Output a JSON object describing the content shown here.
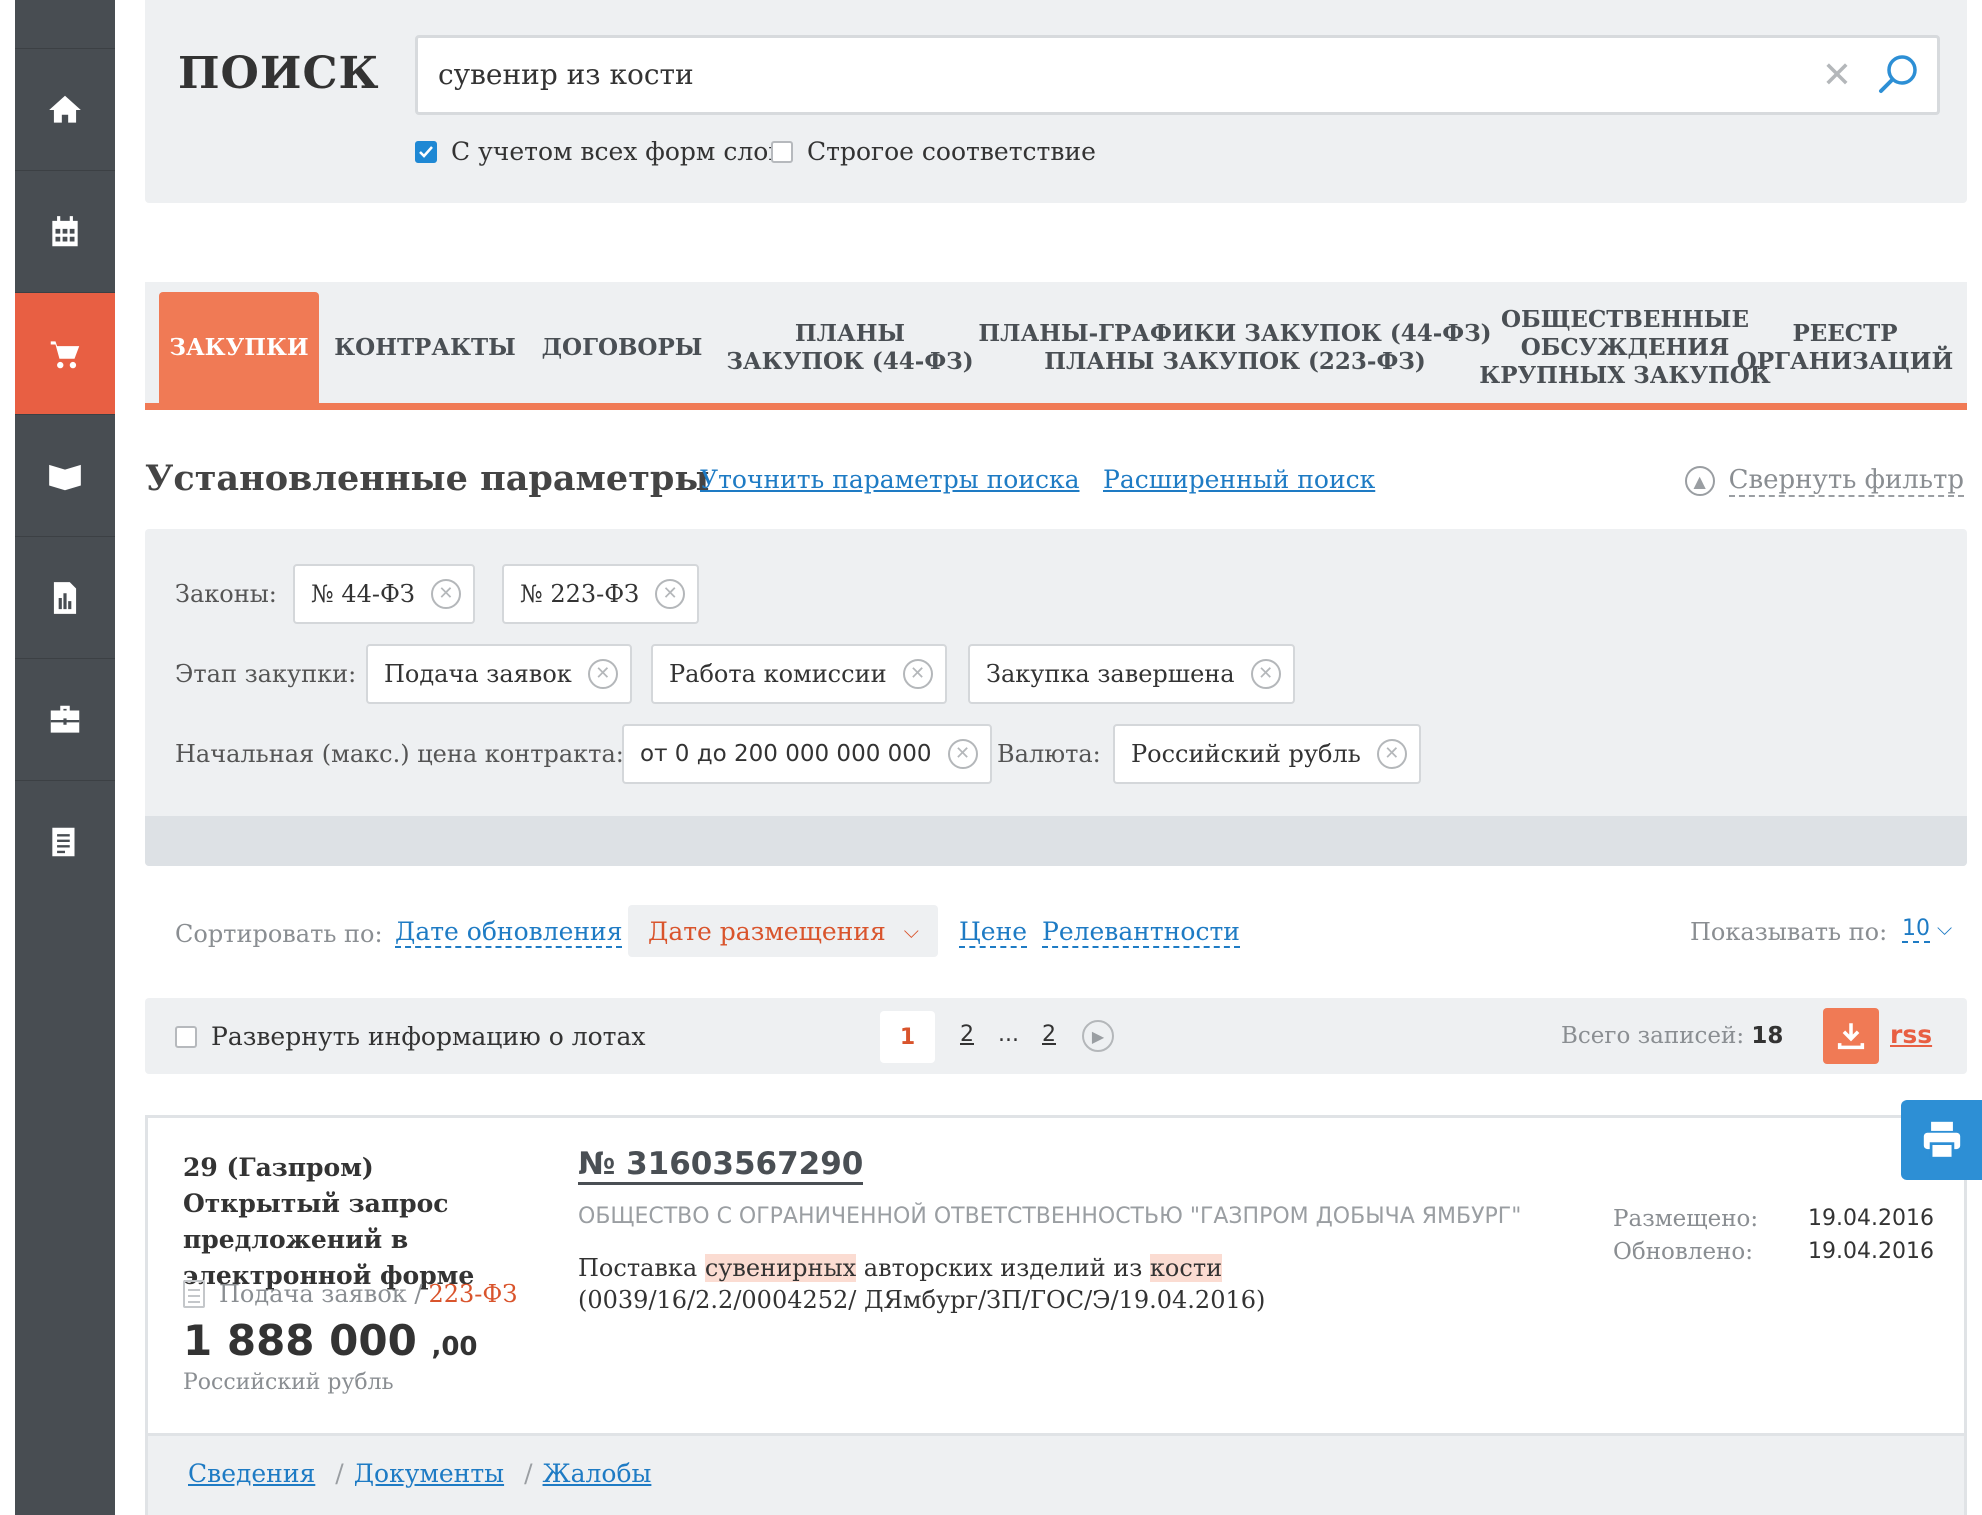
{
  "search": {
    "title": "ПОИСК",
    "query": "сувенир из кости",
    "option_all_forms": "С учетом всех форм слов",
    "option_all_forms_checked": true,
    "option_strict": "Строгое соответствие",
    "option_strict_checked": false
  },
  "tabs": [
    {
      "label": "ЗАКУПКИ",
      "active": true
    },
    {
      "label": "КОНТРАКТЫ"
    },
    {
      "label": "ДОГОВОРЫ"
    },
    {
      "label": "ПЛАНЫ\nЗАКУПОК (44-ФЗ)"
    },
    {
      "label": "ПЛАНЫ-ГРАФИКИ ЗАКУПОК (44-ФЗ)\nПЛАНЫ ЗАКУПОК (223-ФЗ)"
    },
    {
      "label": "ОБЩЕСТВЕННЫЕ\nОБСУЖДЕНИЯ\nКРУПНЫХ ЗАКУПОК"
    },
    {
      "label": "РЕЕСТР\nОРГАНИЗАЦИЙ"
    }
  ],
  "params": {
    "title": "Установленные параметры",
    "refine_link": "Уточнить параметры поиска",
    "advanced_link": "Расширенный поиск",
    "collapse_label": "Свернуть фильтр",
    "laws_label": "Законы:",
    "laws": [
      "№ 44-ФЗ",
      "№ 223-ФЗ"
    ],
    "stage_label": "Этап закупки:",
    "stages": [
      "Подача заявок",
      "Работа комиссии",
      "Закупка завершена"
    ],
    "price_label": "Начальная (макс.) цена контракта:",
    "price_value": "от 0 до 200 000 000 000",
    "currency_label": "Валюта:",
    "currency_value": "Российский рубль"
  },
  "sort": {
    "label": "Сортировать по:",
    "options": [
      "Дате обновления",
      "Дате размещения",
      "Цене",
      "Релевантности"
    ],
    "active": "Дате размещения",
    "show_label": "Показывать по:",
    "show_value": "10"
  },
  "toolbar": {
    "expand_label": "Развернуть информацию о лотах",
    "pages": [
      "1",
      "2",
      "...",
      "2"
    ],
    "current_page": "1",
    "total_label": "Всего записей:",
    "total_value": "18",
    "rss_label": "rss"
  },
  "result": {
    "procedure_type": "29 (Газпром) Открытый запрос предложений в электронной форме",
    "stage": "Подача заявок /",
    "law": "223-ФЗ",
    "price_main": "1 888 000",
    "price_decimal": ",00",
    "currency": "Российский рубль",
    "number": "№ 31603567290",
    "organization": "ОБЩЕСТВО С ОГРАНИЧЕННОЙ ОТВЕТСТВЕННОСТЬЮ \"ГАЗПРОМ ДОБЫЧА ЯМБУРГ\"",
    "subject_parts": [
      "Поставка ",
      "сувенирных",
      " авторских изделий из ",
      "кости",
      " (0039/16/2.2/0004252/ ДЯмбург/ЗП/ГОС/Э/19.04.2016)"
    ],
    "placed_label": "Размещено:",
    "placed_date": "19.04.2016",
    "updated_label": "Обновлено:",
    "updated_date": "19.04.2016",
    "links": [
      "Сведения",
      "Документы",
      "Жалобы"
    ]
  },
  "icons": [
    "home-icon",
    "calendar-icon",
    "cart-icon",
    "book-icon",
    "chart-icon",
    "briefcase-icon",
    "document-icon",
    "search-icon",
    "clear-icon",
    "download-icon",
    "print-icon"
  ],
  "colors": {
    "accent": "#f07a55",
    "sidebar": "#484d52",
    "link": "#1e7bc4",
    "active_sidebar": "#e85f43",
    "print_button": "#2d8fd5"
  }
}
